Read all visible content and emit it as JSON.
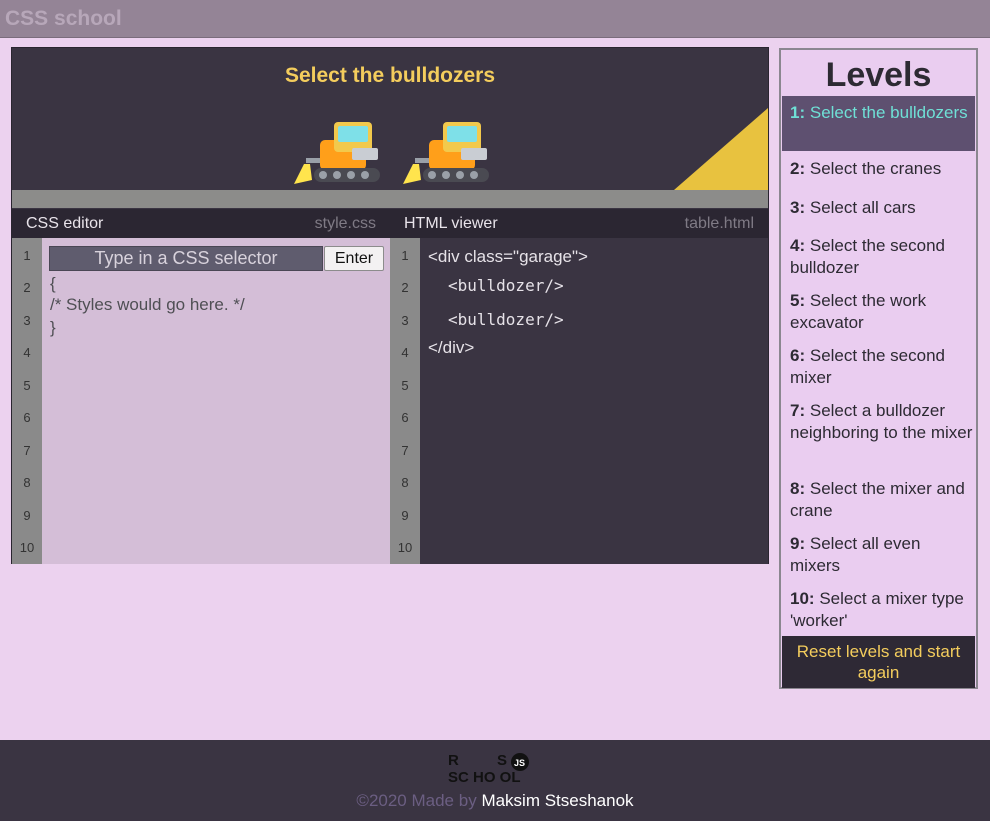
{
  "app": {
    "brand": "CSS school"
  },
  "stage": {
    "instruction": "Select the bulldozers",
    "items": [
      "bulldozer",
      "bulldozer"
    ],
    "colors": {
      "corner": "#e8c23f",
      "title": "#f4cd5d"
    }
  },
  "css_editor": {
    "pane_title": "CSS editor",
    "file_name": "style.css",
    "input_placeholder": "Type in a CSS selector",
    "enter_label": "Enter",
    "lines": [
      "{",
      "/* Styles would go here. */",
      "}"
    ],
    "line_numbers": [
      "1",
      "2",
      "3",
      "4",
      "5",
      "6",
      "7",
      "8",
      "9",
      "10"
    ]
  },
  "html_viewer": {
    "pane_title": "HTML viewer",
    "file_name": "table.html",
    "lines": [
      "<div class=\"garage\">",
      "<bulldozer/>",
      "<bulldozer/>",
      "</div>"
    ],
    "line_numbers": [
      "1",
      "2",
      "3",
      "4",
      "5",
      "6",
      "7",
      "8",
      "9",
      "10"
    ]
  },
  "levels": {
    "title": "Levels",
    "active_index": 0,
    "items": [
      {
        "num": "1:",
        "label": "Select the bulldozers"
      },
      {
        "num": "2:",
        "label": "Select the cranes"
      },
      {
        "num": "3:",
        "label": "Select all cars"
      },
      {
        "num": "4:",
        "label": "Select the second bulldozer"
      },
      {
        "num": "5:",
        "label": "Select the work excavator"
      },
      {
        "num": "6:",
        "label": "Select the second mixer"
      },
      {
        "num": "7:",
        "label": "Select a bulldozer neighboring to the mixer"
      },
      {
        "num": "8:",
        "label": "Select the mixer and crane"
      },
      {
        "num": "9:",
        "label": "Select all even mixers"
      },
      {
        "num": "10:",
        "label": "Select a mixer type 'worker'"
      }
    ],
    "reset_label": "Reset levels and start again"
  },
  "footer": {
    "logo_text": "RS SCHOOL JS",
    "copyright": "©2020 Made by",
    "author": "Maksim Stseshanok"
  }
}
